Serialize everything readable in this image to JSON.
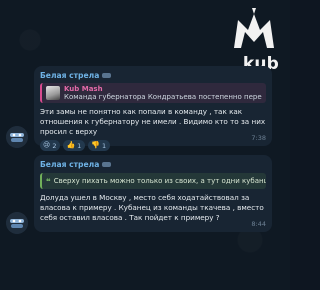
{
  "watermark": {
    "brand_text": "kub"
  },
  "messages": [
    {
      "sender": "Белая стрела",
      "reply": {
        "name": "Kub Mash",
        "text": "Команда губернатора Кондратьева постепенно переe..."
      },
      "text": "Эти замы не понятно как попали в команду , так как отношения к губернатору не имели . Видимо кто то за них просил с верху",
      "reactions": [
        {
          "emoji": "😢",
          "count": "2"
        },
        {
          "emoji": "👍",
          "count": "1"
        },
        {
          "emoji": "👎",
          "count": "1"
        }
      ],
      "time": "7:38"
    },
    {
      "sender": "Белая стрела",
      "quote": "Сверху пихать можно только из своих, а тут одни кубанцы ...",
      "text": "Долуда ушел в Москву , место себя ходатайствовал за власова к примеру . Кубанец из команды ткачева , вместо себя оставил власова . Так пойдет к примеру ?",
      "time": "8:44"
    }
  ],
  "colors": {
    "background": "#0e1621",
    "bubble": "#182533",
    "sender": "#6fb3e6",
    "reply_accent": "#d84b8f",
    "quote_accent": "#71b05a"
  }
}
